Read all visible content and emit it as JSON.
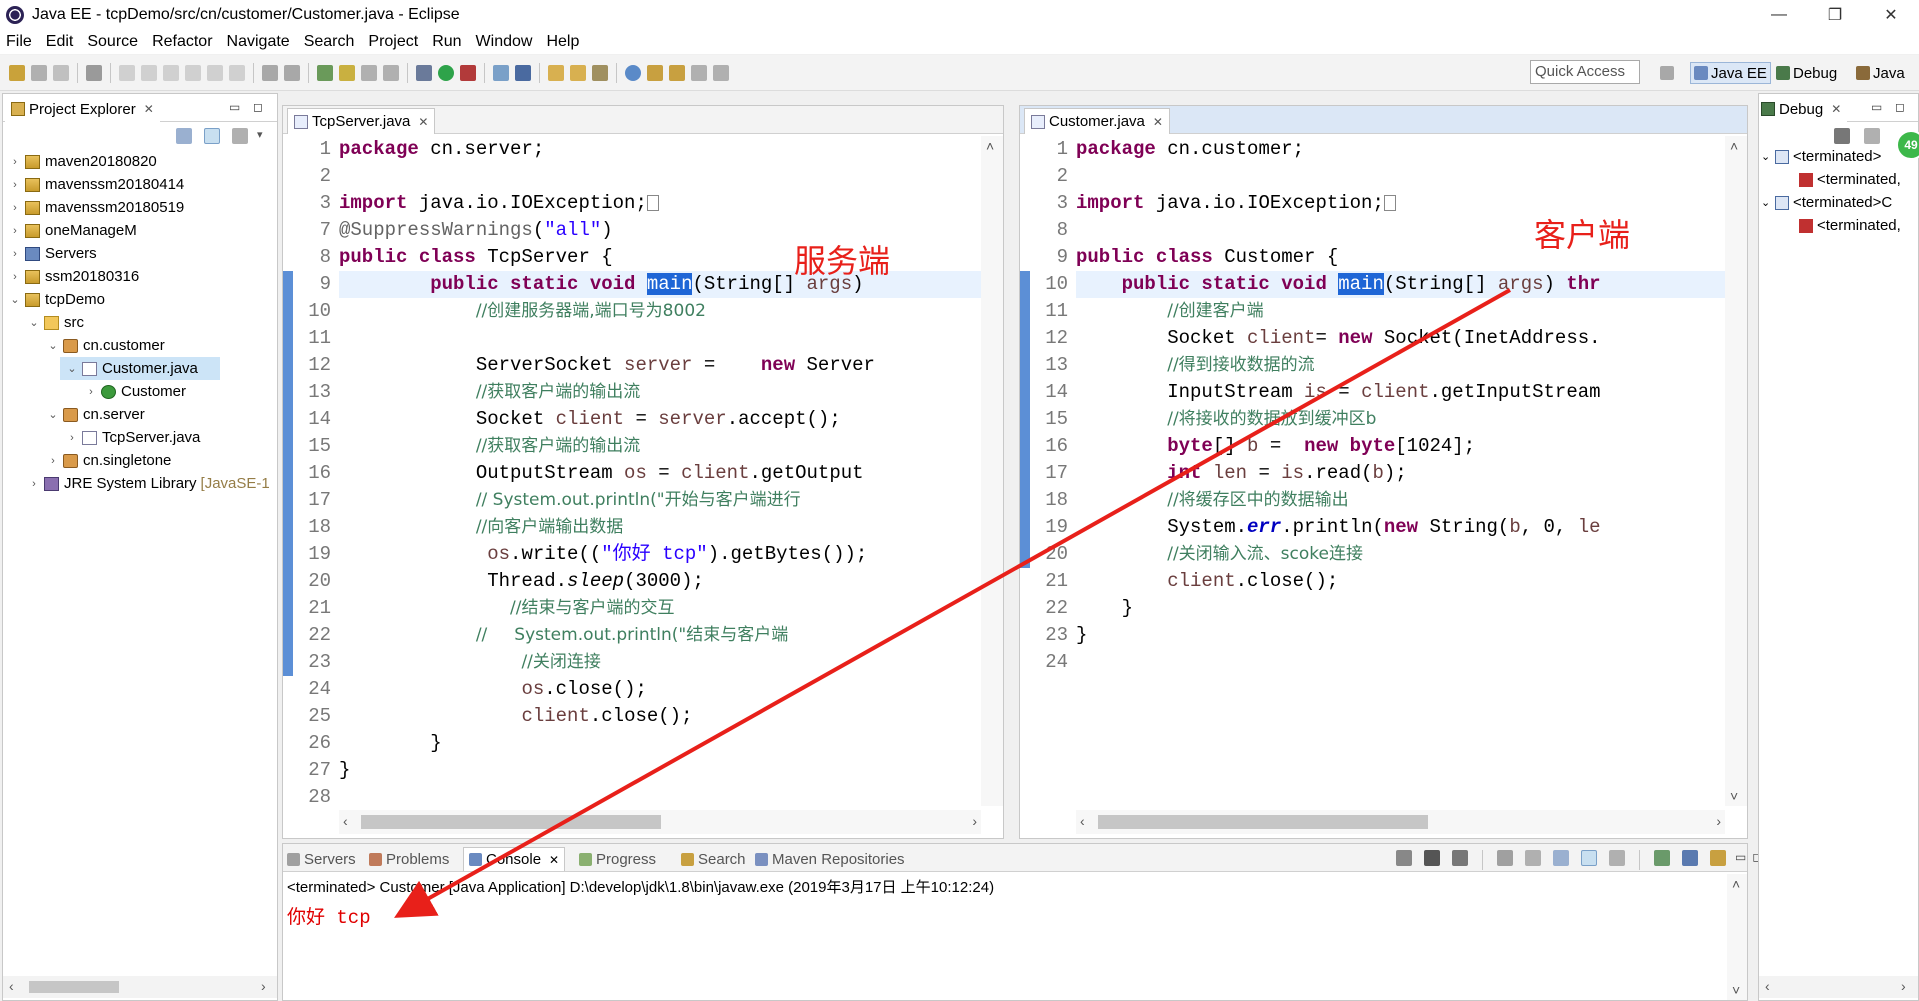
{
  "window": {
    "title": "Java EE - tcpDemo/src/cn/customer/Customer.java - Eclipse",
    "minimize": "—",
    "maximize": "❐",
    "close": "✕"
  },
  "menu": [
    "File",
    "Edit",
    "Source",
    "Refactor",
    "Navigate",
    "Search",
    "Project",
    "Run",
    "Window",
    "Help"
  ],
  "toolbar": {
    "quick_access": "Quick Access",
    "perspectives": [
      "Java EE",
      "Debug",
      "Java"
    ]
  },
  "project_explorer": {
    "title": "Project Explorer",
    "items": [
      {
        "label": "maven20180820",
        "level": 0,
        "arrow": "›",
        "icon": "project-icon"
      },
      {
        "label": "mavenssm20180414",
        "level": 0,
        "arrow": "›",
        "icon": "project-icon"
      },
      {
        "label": "mavenssm20180519",
        "level": 0,
        "arrow": "›",
        "icon": "project-icon"
      },
      {
        "label": "oneManageM",
        "level": 0,
        "arrow": "›",
        "icon": "project-icon"
      },
      {
        "label": "Servers",
        "level": 0,
        "arrow": "›",
        "icon": "servers-icon"
      },
      {
        "label": "ssm20180316",
        "level": 0,
        "arrow": "›",
        "icon": "project-icon"
      },
      {
        "label": "tcpDemo",
        "level": 0,
        "arrow": "⌄",
        "icon": "project-icon"
      },
      {
        "label": "src",
        "level": 1,
        "arrow": "⌄",
        "icon": "source-folder-icon"
      },
      {
        "label": "cn.customer",
        "level": 2,
        "arrow": "⌄",
        "icon": "package-icon"
      },
      {
        "label": "Customer.java",
        "level": 3,
        "arrow": "⌄",
        "icon": "java-file-icon",
        "selected": true
      },
      {
        "label": "Customer",
        "level": 4,
        "arrow": "›",
        "icon": "class-icon"
      },
      {
        "label": "cn.server",
        "level": 2,
        "arrow": "⌄",
        "icon": "package-icon"
      },
      {
        "label": "TcpServer.java",
        "level": 3,
        "arrow": "›",
        "icon": "java-file-icon"
      },
      {
        "label": "cn.singletone",
        "level": 2,
        "arrow": "›",
        "icon": "package-icon"
      },
      {
        "label": "JRE System Library",
        "suffix": "[JavaSE-1",
        "level": 1,
        "arrow": "›",
        "icon": "library-icon"
      }
    ]
  },
  "editor_server": {
    "tab": "TcpServer.java",
    "line_numbers": [
      "1",
      "2",
      "3",
      "7",
      "8",
      "9",
      "10",
      "11",
      "12",
      "13",
      "14",
      "15",
      "16",
      "17",
      "18",
      "19",
      "20",
      "21",
      "22",
      "23",
      "24",
      "25",
      "26",
      "27",
      "28"
    ]
  },
  "editor_customer": {
    "tab": "Customer.java",
    "line_numbers": [
      "1",
      "2",
      "3",
      "8",
      "9",
      "10",
      "11",
      "12",
      "13",
      "14",
      "15",
      "16",
      "17",
      "18",
      "19",
      "20",
      "21",
      "22",
      "23",
      "24"
    ]
  },
  "annotations": {
    "server_label": "服务端",
    "client_label": "客户端"
  },
  "console": {
    "tabs": [
      "Servers",
      "Problems",
      "Console",
      "Progress",
      "Search",
      "Maven Repositories"
    ],
    "terminated_line": "<terminated> Customer [Java Application] D:\\develop\\jdk\\1.8\\bin\\javaw.exe (2019年3月17日 上午10:12:24)",
    "output": "你好 tcp"
  },
  "debug": {
    "title": "Debug",
    "badge": "49",
    "items": [
      "<terminated>",
      "<terminated,",
      "<terminated>C",
      "<terminated,"
    ]
  },
  "colors": {
    "keyword": "#7f0055",
    "comment": "#3f7f5f",
    "string": "#2a00ff",
    "annotation_red": "#e8201a",
    "selection_blue": "#1f66d6"
  }
}
